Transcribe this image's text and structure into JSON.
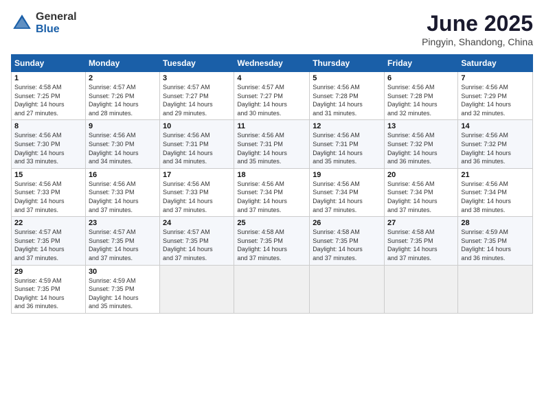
{
  "logo": {
    "general": "General",
    "blue": "Blue"
  },
  "header": {
    "title": "June 2025",
    "subtitle": "Pingyin, Shandong, China"
  },
  "days_of_week": [
    "Sunday",
    "Monday",
    "Tuesday",
    "Wednesday",
    "Thursday",
    "Friday",
    "Saturday"
  ],
  "weeks": [
    [
      {
        "day": "1",
        "info": "Sunrise: 4:58 AM\nSunset: 7:25 PM\nDaylight: 14 hours\nand 27 minutes."
      },
      {
        "day": "2",
        "info": "Sunrise: 4:57 AM\nSunset: 7:26 PM\nDaylight: 14 hours\nand 28 minutes."
      },
      {
        "day": "3",
        "info": "Sunrise: 4:57 AM\nSunset: 7:27 PM\nDaylight: 14 hours\nand 29 minutes."
      },
      {
        "day": "4",
        "info": "Sunrise: 4:57 AM\nSunset: 7:27 PM\nDaylight: 14 hours\nand 30 minutes."
      },
      {
        "day": "5",
        "info": "Sunrise: 4:56 AM\nSunset: 7:28 PM\nDaylight: 14 hours\nand 31 minutes."
      },
      {
        "day": "6",
        "info": "Sunrise: 4:56 AM\nSunset: 7:28 PM\nDaylight: 14 hours\nand 32 minutes."
      },
      {
        "day": "7",
        "info": "Sunrise: 4:56 AM\nSunset: 7:29 PM\nDaylight: 14 hours\nand 32 minutes."
      }
    ],
    [
      {
        "day": "8",
        "info": "Sunrise: 4:56 AM\nSunset: 7:30 PM\nDaylight: 14 hours\nand 33 minutes."
      },
      {
        "day": "9",
        "info": "Sunrise: 4:56 AM\nSunset: 7:30 PM\nDaylight: 14 hours\nand 34 minutes."
      },
      {
        "day": "10",
        "info": "Sunrise: 4:56 AM\nSunset: 7:31 PM\nDaylight: 14 hours\nand 34 minutes."
      },
      {
        "day": "11",
        "info": "Sunrise: 4:56 AM\nSunset: 7:31 PM\nDaylight: 14 hours\nand 35 minutes."
      },
      {
        "day": "12",
        "info": "Sunrise: 4:56 AM\nSunset: 7:31 PM\nDaylight: 14 hours\nand 35 minutes."
      },
      {
        "day": "13",
        "info": "Sunrise: 4:56 AM\nSunset: 7:32 PM\nDaylight: 14 hours\nand 36 minutes."
      },
      {
        "day": "14",
        "info": "Sunrise: 4:56 AM\nSunset: 7:32 PM\nDaylight: 14 hours\nand 36 minutes."
      }
    ],
    [
      {
        "day": "15",
        "info": "Sunrise: 4:56 AM\nSunset: 7:33 PM\nDaylight: 14 hours\nand 37 minutes."
      },
      {
        "day": "16",
        "info": "Sunrise: 4:56 AM\nSunset: 7:33 PM\nDaylight: 14 hours\nand 37 minutes."
      },
      {
        "day": "17",
        "info": "Sunrise: 4:56 AM\nSunset: 7:33 PM\nDaylight: 14 hours\nand 37 minutes."
      },
      {
        "day": "18",
        "info": "Sunrise: 4:56 AM\nSunset: 7:34 PM\nDaylight: 14 hours\nand 37 minutes."
      },
      {
        "day": "19",
        "info": "Sunrise: 4:56 AM\nSunset: 7:34 PM\nDaylight: 14 hours\nand 37 minutes."
      },
      {
        "day": "20",
        "info": "Sunrise: 4:56 AM\nSunset: 7:34 PM\nDaylight: 14 hours\nand 37 minutes."
      },
      {
        "day": "21",
        "info": "Sunrise: 4:56 AM\nSunset: 7:34 PM\nDaylight: 14 hours\nand 38 minutes."
      }
    ],
    [
      {
        "day": "22",
        "info": "Sunrise: 4:57 AM\nSunset: 7:35 PM\nDaylight: 14 hours\nand 37 minutes."
      },
      {
        "day": "23",
        "info": "Sunrise: 4:57 AM\nSunset: 7:35 PM\nDaylight: 14 hours\nand 37 minutes."
      },
      {
        "day": "24",
        "info": "Sunrise: 4:57 AM\nSunset: 7:35 PM\nDaylight: 14 hours\nand 37 minutes."
      },
      {
        "day": "25",
        "info": "Sunrise: 4:58 AM\nSunset: 7:35 PM\nDaylight: 14 hours\nand 37 minutes."
      },
      {
        "day": "26",
        "info": "Sunrise: 4:58 AM\nSunset: 7:35 PM\nDaylight: 14 hours\nand 37 minutes."
      },
      {
        "day": "27",
        "info": "Sunrise: 4:58 AM\nSunset: 7:35 PM\nDaylight: 14 hours\nand 37 minutes."
      },
      {
        "day": "28",
        "info": "Sunrise: 4:59 AM\nSunset: 7:35 PM\nDaylight: 14 hours\nand 36 minutes."
      }
    ],
    [
      {
        "day": "29",
        "info": "Sunrise: 4:59 AM\nSunset: 7:35 PM\nDaylight: 14 hours\nand 36 minutes."
      },
      {
        "day": "30",
        "info": "Sunrise: 4:59 AM\nSunset: 7:35 PM\nDaylight: 14 hours\nand 35 minutes."
      },
      {
        "day": "",
        "info": ""
      },
      {
        "day": "",
        "info": ""
      },
      {
        "day": "",
        "info": ""
      },
      {
        "day": "",
        "info": ""
      },
      {
        "day": "",
        "info": ""
      }
    ]
  ]
}
